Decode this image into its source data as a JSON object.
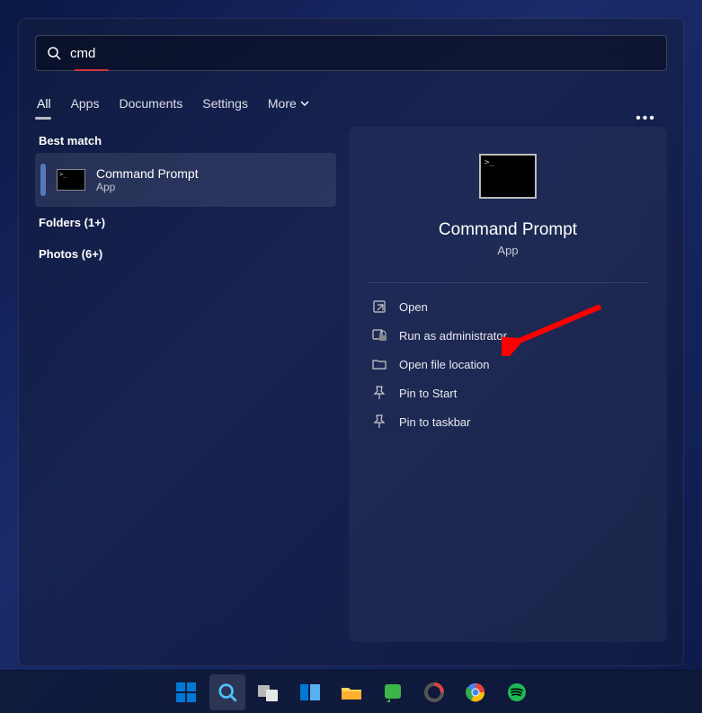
{
  "search": {
    "value": "cmd"
  },
  "tabs": [
    "All",
    "Apps",
    "Documents",
    "Settings",
    "More"
  ],
  "active_tab": 0,
  "best_match": {
    "heading": "Best match",
    "title": "Command Prompt",
    "subtitle": "App"
  },
  "categories": [
    {
      "label": "Folders (1+)"
    },
    {
      "label": "Photos (6+)"
    }
  ],
  "detail": {
    "title": "Command Prompt",
    "subtitle": "App",
    "actions": [
      {
        "icon": "open-icon",
        "label": "Open"
      },
      {
        "icon": "admin-icon",
        "label": "Run as administrator"
      },
      {
        "icon": "folder-icon",
        "label": "Open file location"
      },
      {
        "icon": "pin-start-icon",
        "label": "Pin to Start"
      },
      {
        "icon": "pin-taskbar-icon",
        "label": "Pin to taskbar"
      }
    ]
  },
  "taskbar": [
    "start",
    "search",
    "taskview",
    "widgets",
    "explorer",
    "app1",
    "app2",
    "chrome",
    "spotify"
  ]
}
